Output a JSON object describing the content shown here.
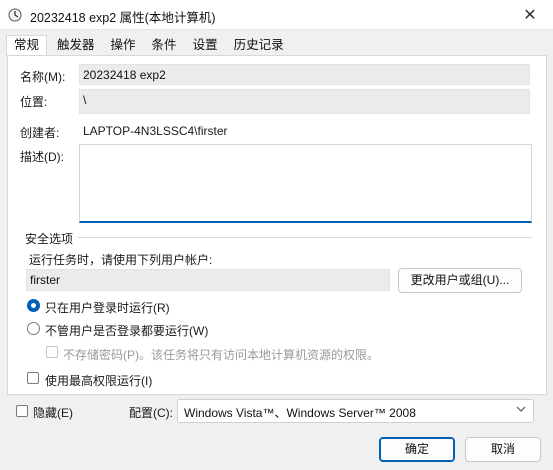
{
  "window": {
    "title": "20232418 exp2 属性(本地计算机)",
    "close_glyph": "✕"
  },
  "tabs": [
    {
      "label": "常规",
      "active": true
    },
    {
      "label": "触发器"
    },
    {
      "label": "操作"
    },
    {
      "label": "条件"
    },
    {
      "label": "设置"
    },
    {
      "label": "历史记录"
    }
  ],
  "general": {
    "name_label": "名称(M):",
    "name_value": "20232418 exp2",
    "location_label": "位置:",
    "location_value": "\\",
    "author_label": "创建者:",
    "author_value": "LAPTOP-4N3LSSC4\\firster",
    "description_label": "描述(D):",
    "description_value": ""
  },
  "security": {
    "group_title": "安全选项",
    "run_as_text": "运行任务时，请使用下列用户帐户:",
    "user_value": "firster",
    "change_user_button": "更改用户或组(U)...",
    "radio_logged_on": "只在用户登录时运行(R)",
    "radio_logged_on_selected": true,
    "radio_any": "不管用户是否登录都要运行(W)",
    "no_store_password": "不存储密码(P)。该任务将只有访问本地计算机资源的权限。",
    "highest_privileges": "使用最高权限运行(I)"
  },
  "footer": {
    "hidden_label": "隐藏(E)",
    "config_label": "配置(C):",
    "config_value": "Windows Vista™、Windows Server™ 2008",
    "ok_button": "确定",
    "cancel_button": "取消"
  },
  "colors": {
    "accent": "#005fb8"
  }
}
